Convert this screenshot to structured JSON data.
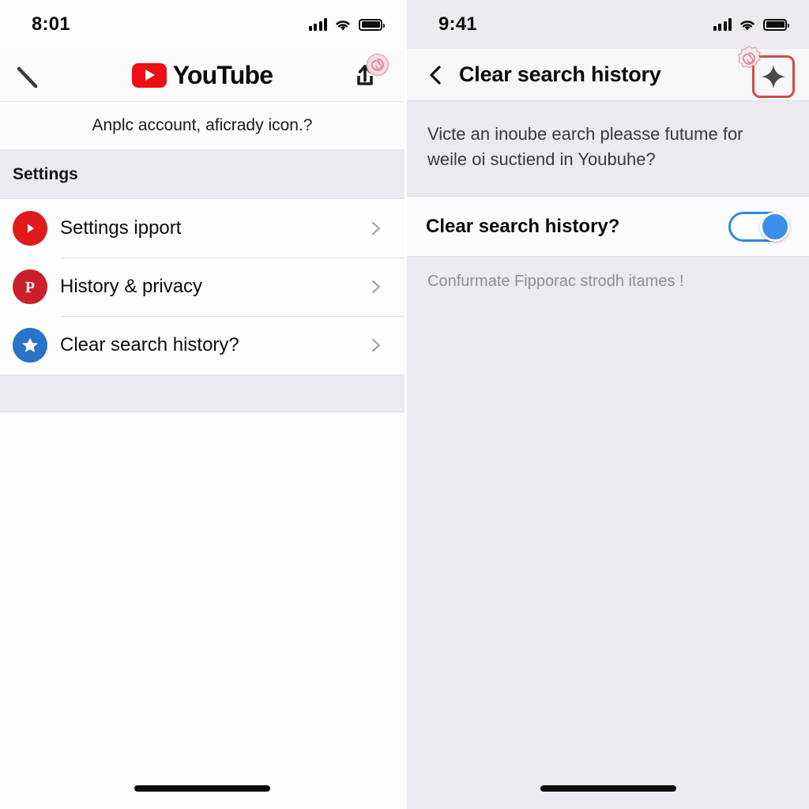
{
  "left": {
    "status": {
      "time": "8:01",
      "signal_icon": "cellular-signal-icon",
      "wifi_icon": "wifi-icon",
      "battery_icon": "battery-icon"
    },
    "appbar": {
      "back_icon": "back-arrow-partial-icon",
      "logo_text": "YouTube",
      "logo_icon": "youtube-play-icon",
      "share_icon": "share-upload-icon",
      "badge_icon": "pink-spiral-badge-icon"
    },
    "subtitle": "Anplc account, aficrady icon.?",
    "section_header": "Settings",
    "rows": [
      {
        "label": "Settings ipport",
        "icon": "youtube-play-circle-icon",
        "icon_color": "#e01b1b",
        "chevron": "chevron-right-icon"
      },
      {
        "label": "History & privacy",
        "icon": "pinterest-icon",
        "icon_color": "#c9202a",
        "chevron": "chevron-right-icon"
      },
      {
        "label": "Clear search history?",
        "icon": "star-circle-icon",
        "icon_color": "#2b72c9",
        "chevron": "chevron-right-icon"
      }
    ]
  },
  "right": {
    "status": {
      "time": "9:41",
      "signal_icon": "cellular-signal-icon",
      "wifi_icon": "wifi-icon",
      "battery_icon": "battery-icon"
    },
    "appbar": {
      "back_icon": "chevron-left-icon",
      "title": "Clear search history",
      "action_icon": "sparkle-icon",
      "badge_icon": "pink-spiral-badge-icon",
      "highlight_color": "#d24c4c"
    },
    "description": "Victe an inoube earch pleasse futume for weile oi suctiend in Youbuhe?",
    "toggle": {
      "label": "Clear search history?",
      "state": "on",
      "accent_color": "#3b8fe8"
    },
    "hint": "Confurmate Fipporac strodh itames !"
  }
}
